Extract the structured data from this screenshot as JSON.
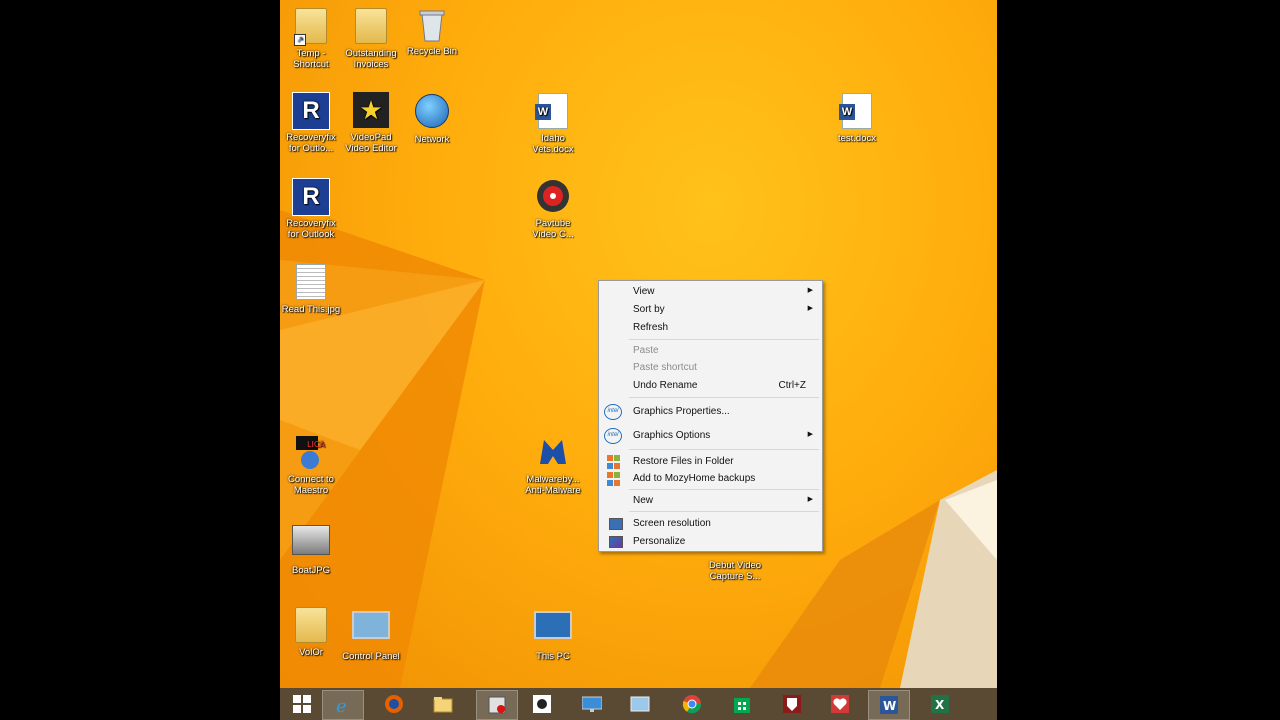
{
  "desktop": {
    "icons": [
      {
        "id": "temp",
        "label": "Temp -\nShortcut"
      },
      {
        "id": "outstanding",
        "label": "Outstanding\nInvoices"
      },
      {
        "id": "recycle",
        "label": "Recycle Bin"
      },
      {
        "id": "recoveryfix1",
        "label": "Recoveryfix\nfor Outlo..."
      },
      {
        "id": "videopad",
        "label": "VideoPad\nVideo Editor"
      },
      {
        "id": "network",
        "label": "Network"
      },
      {
        "id": "idaho",
        "label": "Idaho\nVets.docx"
      },
      {
        "id": "testdocx",
        "label": "test.docx"
      },
      {
        "id": "recoveryfix2",
        "label": "Recoveryfix\nfor Outlook"
      },
      {
        "id": "pavtube",
        "label": "Pavtube\nVideo C..."
      },
      {
        "id": "readthis",
        "label": "Read This.jpg"
      },
      {
        "id": "maestro",
        "label": "Connect to\nMaestro"
      },
      {
        "id": "malwarebytes",
        "label": "Malwareby...\nAnti-Malware"
      },
      {
        "id": "boatjpg",
        "label": "BoatJPG"
      },
      {
        "id": "debut",
        "label": "Debut Video\nCapture S..."
      },
      {
        "id": "volor",
        "label": "VolOr"
      },
      {
        "id": "controlpanel",
        "label": "Control Panel"
      },
      {
        "id": "thispc",
        "label": "This PC"
      }
    ]
  },
  "context_menu": {
    "view": "View",
    "sort_by": "Sort by",
    "refresh": "Refresh",
    "paste": "Paste",
    "paste_shortcut": "Paste shortcut",
    "undo_rename": "Undo Rename",
    "undo_rename_shortcut": "Ctrl+Z",
    "graphics_properties": "Graphics Properties...",
    "graphics_options": "Graphics Options",
    "restore_files": "Restore Files in Folder",
    "add_mozy": "Add to MozyHome backups",
    "new": "New",
    "screen_resolution": "Screen resolution",
    "personalize": "Personalize",
    "intel_badge": "intel"
  },
  "taskbar": {
    "items": [
      "start",
      "internet-explorer",
      "firefox",
      "file-explorer",
      "recorder",
      "inkscape",
      "lenovo",
      "remote",
      "chrome",
      "store",
      "nfl",
      "health",
      "word",
      "excel"
    ]
  },
  "colors": {
    "wallpaper": "#ffad0d",
    "taskbar": "#5a4a33",
    "menu_bg": "#f3f3f3"
  }
}
